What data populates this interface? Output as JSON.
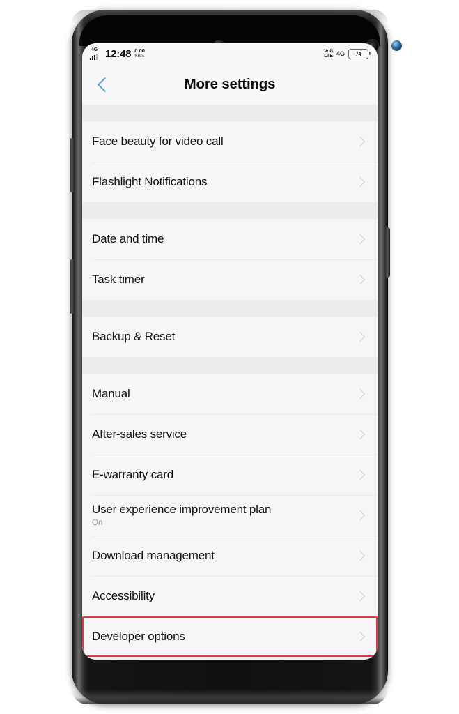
{
  "device": {
    "hardware": {
      "volume_up": "volume-up-button",
      "volume_down": "volume-down-button",
      "power": "power-button"
    }
  },
  "status_bar": {
    "network_type": "4G",
    "time": "12:48",
    "net_speed_value": "0.00",
    "net_speed_unit": "KB/s",
    "volte_line1": "VoLTE",
    "volte_line2": "LTE",
    "volte_top": "VoI)",
    "volte_bottom": "LTE",
    "network_right": "4G",
    "battery_level": "74"
  },
  "header": {
    "back_icon": "chevron-left-icon",
    "title": "More settings"
  },
  "settings": {
    "groups": [
      {
        "rows": [
          {
            "title": "Face beauty for video call",
            "subtitle": "",
            "highlighted": false
          },
          {
            "title": "Flashlight Notifications",
            "subtitle": "",
            "highlighted": false
          }
        ]
      },
      {
        "rows": [
          {
            "title": "Date and time",
            "subtitle": "",
            "highlighted": false
          },
          {
            "title": "Task timer",
            "subtitle": "",
            "highlighted": false
          }
        ]
      },
      {
        "rows": [
          {
            "title": "Backup & Reset",
            "subtitle": "",
            "highlighted": false
          }
        ]
      },
      {
        "rows": [
          {
            "title": "Manual",
            "subtitle": "",
            "highlighted": false
          },
          {
            "title": "After-sales service",
            "subtitle": "",
            "highlighted": false
          },
          {
            "title": "E-warranty card",
            "subtitle": "",
            "highlighted": false
          },
          {
            "title": "User experience improvement plan",
            "subtitle": "On",
            "highlighted": false
          },
          {
            "title": "Download management",
            "subtitle": "",
            "highlighted": false
          },
          {
            "title": "Accessibility",
            "subtitle": "",
            "highlighted": false
          },
          {
            "title": "Developer options",
            "subtitle": "",
            "highlighted": true
          }
        ]
      }
    ]
  },
  "annotation": {
    "highlight_color": "#e0393e",
    "highlight_target": "Developer options"
  }
}
